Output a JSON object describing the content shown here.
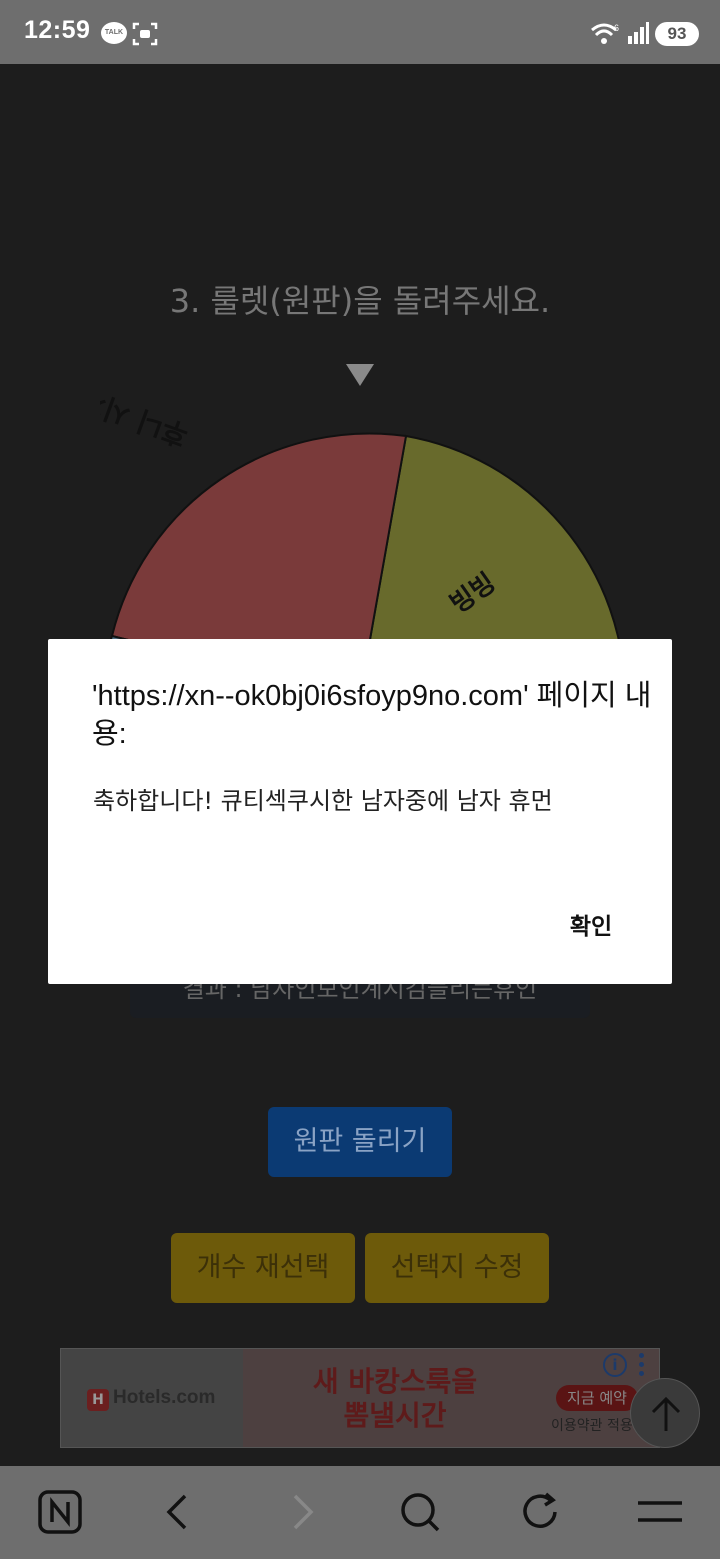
{
  "status_bar": {
    "time": "12:59",
    "talk_badge": "TALK",
    "battery": "93"
  },
  "page": {
    "heading": "3. 룰렛(원판)을 돌려주세요.",
    "wheel_labels": [
      "후니 시계쌤의 우들",
      "빙빙"
    ],
    "wheel_colors": [
      "#7a3a3a",
      "#686a2c",
      "#4c6c80"
    ],
    "result_text": "결과 : 남자인보인계시김들리는휴인",
    "spin_button": "원판 돌리기",
    "recount_button": "개수 재선택",
    "edit_button": "선택지 수정"
  },
  "ad": {
    "brand": "Hotels.com",
    "headline_line1": "새 바캉스룩을",
    "headline_line2": "뽐낼시간",
    "cta": "지금 예약",
    "terms": "이용약관 적용"
  },
  "dialog": {
    "title": "'https://xn--ok0bj0i6sfoyp9no.com' 페이지 내용:",
    "message": "축하합니다! 큐티섹쿠시한 남자중에 남자 휴먼",
    "ok_label": "확인"
  },
  "bottom_bar": {
    "icons": [
      "naver-home-icon",
      "back-arrow-icon",
      "forward-arrow-icon",
      "search-icon",
      "refresh-icon",
      "menu-icon"
    ]
  }
}
